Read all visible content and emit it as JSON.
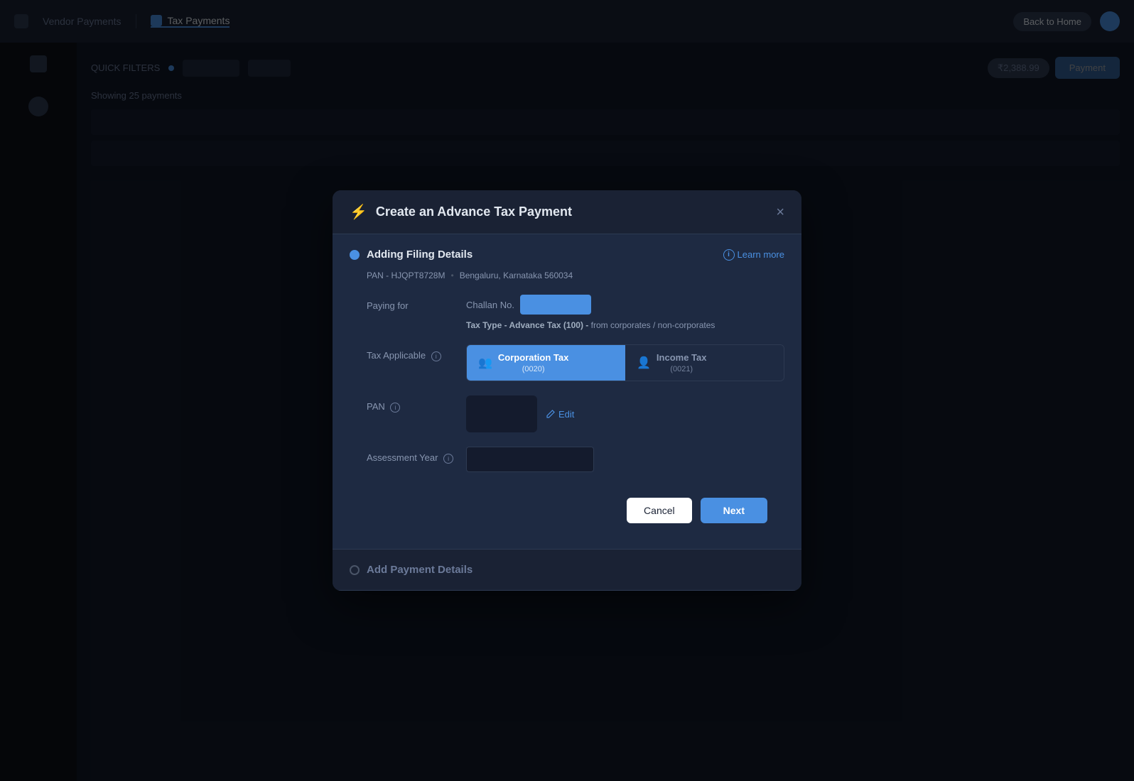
{
  "app": {
    "title": "Tax Payments",
    "nav_items": [
      {
        "label": "Vendor Payments",
        "active": false
      },
      {
        "label": "Tax Payments",
        "active": true
      }
    ],
    "user_button": "Back to Home",
    "quick_filters_label": "QUICK FILTERS",
    "payments_info": "Showing 25 payments",
    "total_badge": "₹2,388.99"
  },
  "modal": {
    "title": "Create an Advance Tax Payment",
    "close_label": "×",
    "icon": "⚡",
    "step1": {
      "label": "Adding Filing Details",
      "subtitle_pan": "PAN - HJQPT8728M",
      "subtitle_location": "Bengaluru, Karnataka 560034",
      "learn_more_label": "Learn more",
      "paying_for_label": "Paying for",
      "challan_label": "Challan No.",
      "tax_type_text": "Tax Type - Advance Tax (100) -",
      "tax_type_desc": "from corporates / non-corporates",
      "tax_applicable_label": "Tax Applicable",
      "info_icon": "i",
      "tax_options": [
        {
          "name": "Corporation Tax",
          "code": "(0020)",
          "selected": true,
          "icon": "👥"
        },
        {
          "name": "Income Tax",
          "code": "(0021)",
          "selected": false,
          "icon": "👤"
        }
      ],
      "pan_label": "PAN",
      "pan_edit_label": "Edit",
      "assessment_year_label": "Assessment Year",
      "cancel_label": "Cancel",
      "next_label": "Next"
    },
    "step2": {
      "label": "Add Payment Details",
      "active": false
    }
  },
  "colors": {
    "accent": "#4a90e2",
    "bg_dark": "#0d1117",
    "bg_card": "#1e2a42",
    "bg_nav": "#1a2234",
    "text_primary": "#e2e8f0",
    "text_secondary": "#8896b0",
    "border": "#2d3a52",
    "step_active": "#4a90e2",
    "step_inactive": "#4a5568"
  }
}
